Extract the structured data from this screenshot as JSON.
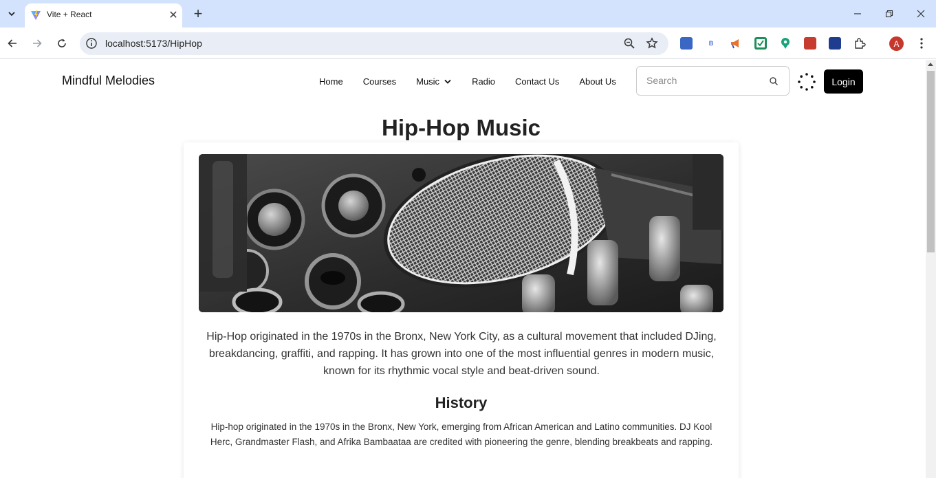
{
  "browser": {
    "tab_title": "Vite + React",
    "url": "localhost:5173/HipHop",
    "profile_initial": "A"
  },
  "site": {
    "brand": "Mindful Melodies",
    "nav": [
      {
        "label": "Home"
      },
      {
        "label": "Courses"
      },
      {
        "label": "Music"
      },
      {
        "label": "Radio"
      },
      {
        "label": "Contact Us"
      },
      {
        "label": "About Us"
      }
    ],
    "search_placeholder": "Search",
    "login_label": "Login"
  },
  "content": {
    "title": "Hip-Hop Music",
    "intro": "Hip-Hop originated in the 1970s in the Bronx, New York City, as a cultural movement that included DJing, breakdancing, graffiti, and rapping. It has grown into one of the most influential genres in modern music, known for its rhythmic vocal style and beat-driven sound.",
    "history_heading": "History",
    "history_text": "Hip-hop originated in the 1970s in the Bronx, New York, emerging from African American and Latino communities. DJ Kool Herc, Grandmaster Flash, and Afrika Bambaataa are credited with pioneering the genre, blending breakbeats and rapping."
  },
  "icons": {
    "tab_favicon": "vite-logo-icon",
    "hero_image": "microphone-mixer-photo"
  },
  "colors": {
    "tabstrip": "#d3e3fd",
    "omnibox": "#e9eef6",
    "login_bg": "#000000",
    "avatar": "#c6372c"
  }
}
